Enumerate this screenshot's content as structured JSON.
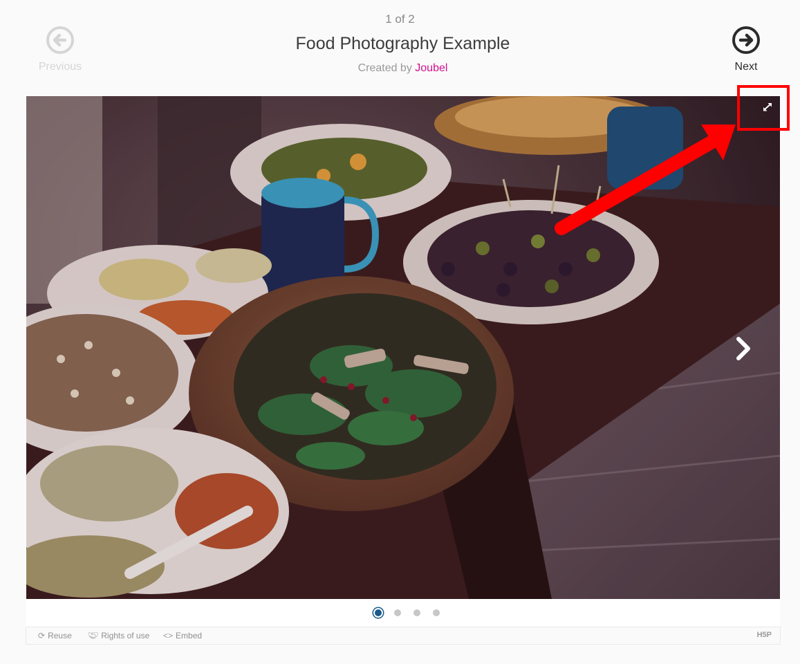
{
  "header": {
    "counter": "1 of 2",
    "title": "Food Photography Example",
    "byline_prefix": "Created by",
    "author": "Joubel"
  },
  "nav": {
    "previous_label": "Previous",
    "next_label": "Next"
  },
  "slider": {
    "total_dots": 4,
    "active_dot": 1
  },
  "footer": {
    "reuse": "Reuse",
    "rights": "Rights of use",
    "embed": "Embed",
    "logo": "H5P"
  },
  "icons": {
    "previous": "arrow-left-circle-icon",
    "next": "arrow-right-circle-icon",
    "fullscreen": "expand-icon",
    "slide_next": "chevron-right-icon",
    "reuse": "refresh-icon",
    "rights": "handshake-icon",
    "embed": "code-icon"
  },
  "colors": {
    "author": "#d10f8d",
    "annotation": "#ff0000",
    "active_dot": "#1a5a8a"
  }
}
